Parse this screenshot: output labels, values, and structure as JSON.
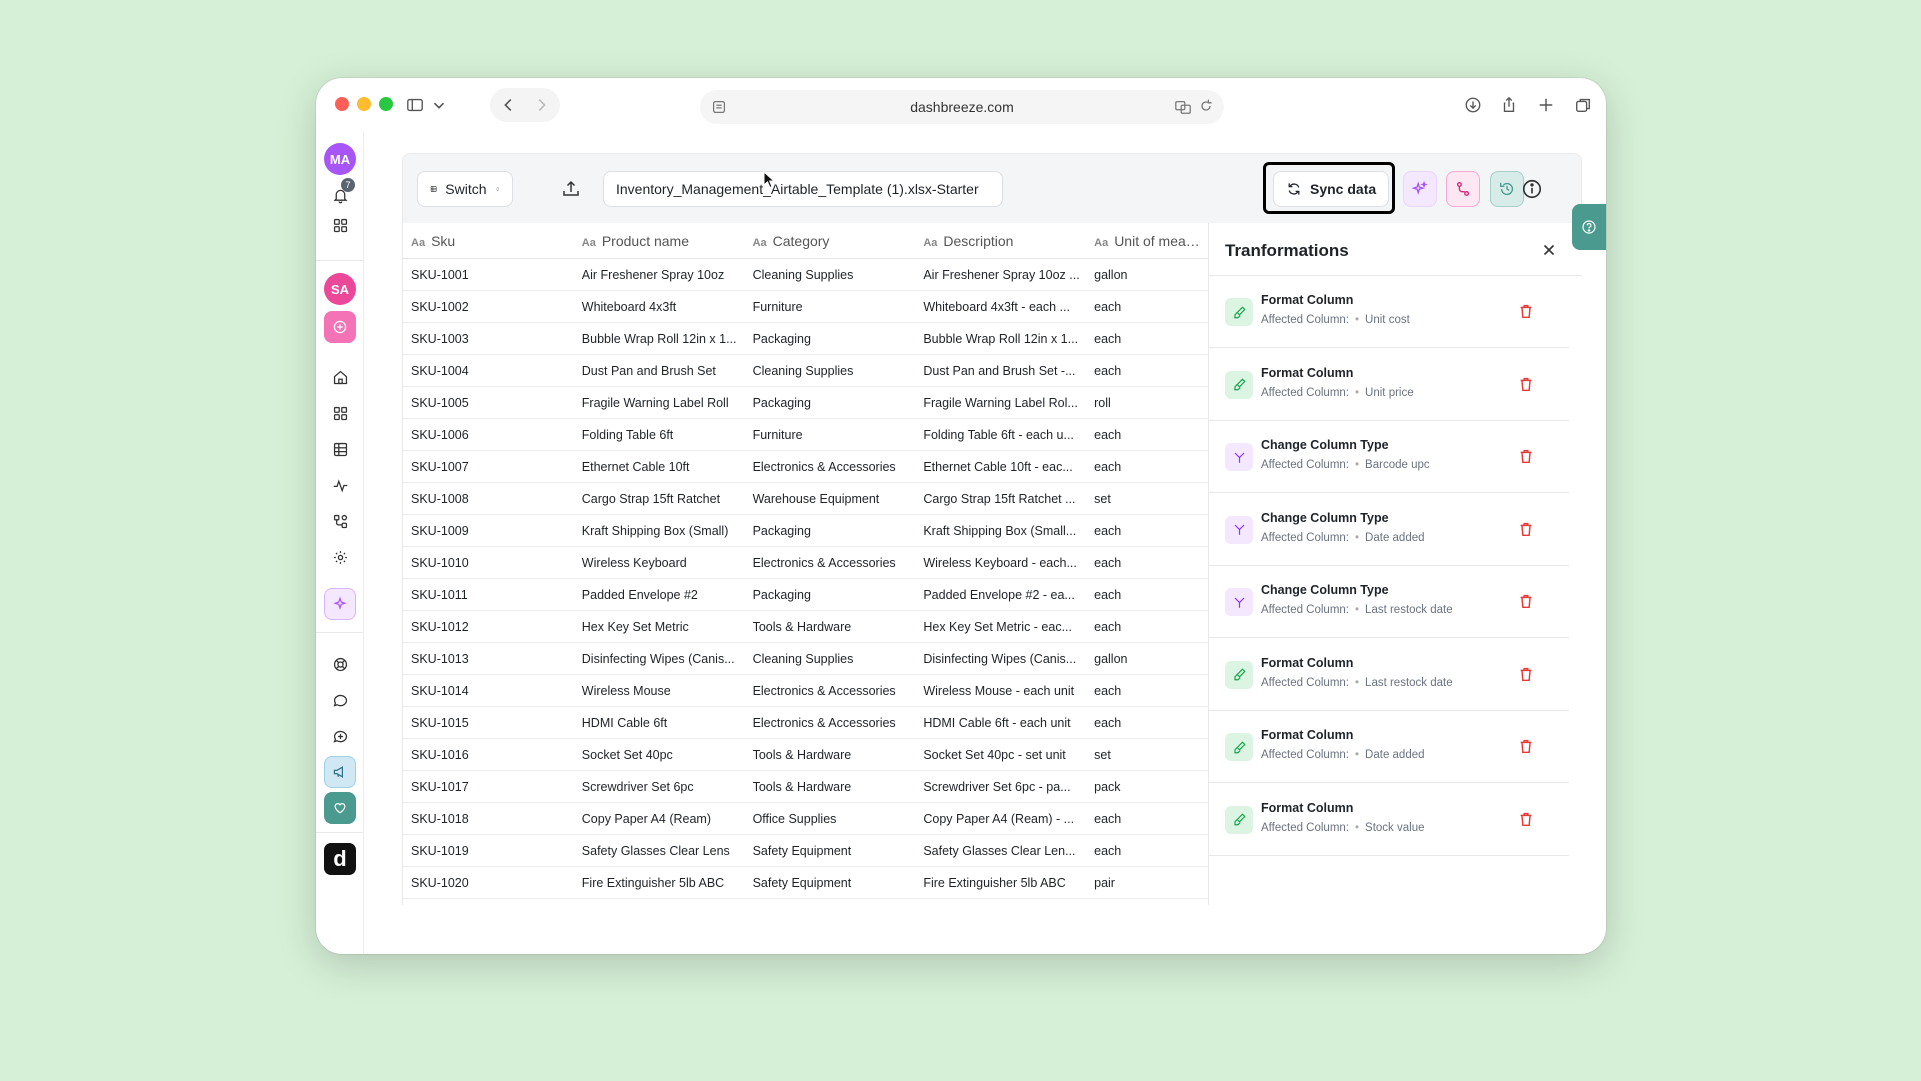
{
  "browser": {
    "url": "dashbreeze.com"
  },
  "rail": {
    "avatar_top": "MA",
    "avatar_top_color": "#a855f7",
    "notification_count": "7",
    "avatar_second": "SA",
    "avatar_second_color": "#ec4899",
    "logo_letter": "d"
  },
  "toolbar": {
    "switch_label": "Switch",
    "file_name": "Inventory_Management_Airtable_Template (1).xlsx-Starter",
    "sync_label": "Sync data"
  },
  "table": {
    "columns": [
      "Sku",
      "Product name",
      "Category",
      "Description",
      "Unit of measure"
    ],
    "rows": [
      [
        "SKU-1001",
        "Air Freshener Spray 10oz",
        "Cleaning Supplies",
        "Air Freshener Spray 10oz ...",
        "gallon"
      ],
      [
        "SKU-1002",
        "Whiteboard 4x3ft",
        "Furniture",
        "Whiteboard 4x3ft - each ...",
        "each"
      ],
      [
        "SKU-1003",
        "Bubble Wrap Roll 12in x 1...",
        "Packaging",
        "Bubble Wrap Roll 12in x 1...",
        "each"
      ],
      [
        "SKU-1004",
        "Dust Pan and Brush Set",
        "Cleaning Supplies",
        "Dust Pan and Brush Set -...",
        "each"
      ],
      [
        "SKU-1005",
        "Fragile Warning Label Roll",
        "Packaging",
        "Fragile Warning Label Rol...",
        "roll"
      ],
      [
        "SKU-1006",
        "Folding Table 6ft",
        "Furniture",
        "Folding Table 6ft - each u...",
        "each"
      ],
      [
        "SKU-1007",
        "Ethernet Cable 10ft",
        "Electronics & Accessories",
        "Ethernet Cable 10ft - eac...",
        "each"
      ],
      [
        "SKU-1008",
        "Cargo Strap 15ft Ratchet",
        "Warehouse Equipment",
        "Cargo Strap 15ft Ratchet ...",
        "set"
      ],
      [
        "SKU-1009",
        "Kraft Shipping Box (Small)",
        "Packaging",
        "Kraft Shipping Box (Small...",
        "each"
      ],
      [
        "SKU-1010",
        "Wireless Keyboard",
        "Electronics & Accessories",
        "Wireless Keyboard - each...",
        "each"
      ],
      [
        "SKU-1011",
        "Padded Envelope #2",
        "Packaging",
        "Padded Envelope #2 - ea...",
        "each"
      ],
      [
        "SKU-1012",
        "Hex Key Set Metric",
        "Tools & Hardware",
        "Hex Key Set Metric - eac...",
        "each"
      ],
      [
        "SKU-1013",
        "Disinfecting Wipes (Canis...",
        "Cleaning Supplies",
        "Disinfecting Wipes (Canis...",
        "gallon"
      ],
      [
        "SKU-1014",
        "Wireless Mouse",
        "Electronics & Accessories",
        "Wireless Mouse - each unit",
        "each"
      ],
      [
        "SKU-1015",
        "HDMI Cable 6ft",
        "Electronics & Accessories",
        "HDMI Cable 6ft - each unit",
        "each"
      ],
      [
        "SKU-1016",
        "Socket Set 40pc",
        "Tools & Hardware",
        "Socket Set 40pc - set unit",
        "set"
      ],
      [
        "SKU-1017",
        "Screwdriver Set 6pc",
        "Tools & Hardware",
        "Screwdriver Set 6pc - pa...",
        "pack"
      ],
      [
        "SKU-1018",
        "Copy Paper A4 (Ream)",
        "Office Supplies",
        "Copy Paper A4 (Ream) - ...",
        "each"
      ],
      [
        "SKU-1019",
        "Safety Glasses Clear Lens",
        "Safety Equipment",
        "Safety Glasses Clear Len...",
        "each"
      ],
      [
        "SKU-1020",
        "Fire Extinguisher 5lb ABC",
        "Safety Equipment",
        "Fire Extinguisher 5lb ABC",
        "pair"
      ]
    ]
  },
  "panel": {
    "title": "Tranformations",
    "affected_label": "Affected Column:",
    "items": [
      {
        "type": "format",
        "title": "Format Column",
        "column": "Unit cost"
      },
      {
        "type": "change",
        "title": "Format Column",
        "column": "Unit price"
      },
      {
        "type": "change",
        "title": "Change Column Type",
        "column": "Barcode upc"
      },
      {
        "type": "change",
        "title": "Change Column Type",
        "column": "Date added"
      },
      {
        "type": "change",
        "title": "Change Column Type",
        "column": "Last restock date"
      },
      {
        "type": "format",
        "title": "Format Column",
        "column": "Last restock date"
      },
      {
        "type": "format",
        "title": "Format Column",
        "column": "Date added"
      },
      {
        "type": "format",
        "title": "Format Column",
        "column": "Stock value"
      }
    ]
  },
  "colors": {
    "format_bg": "#dcf5e3",
    "format_fg": "#16a34a",
    "change_bg": "#f3e8ff",
    "change_fg": "#9333ea",
    "delete": "#e53935"
  }
}
